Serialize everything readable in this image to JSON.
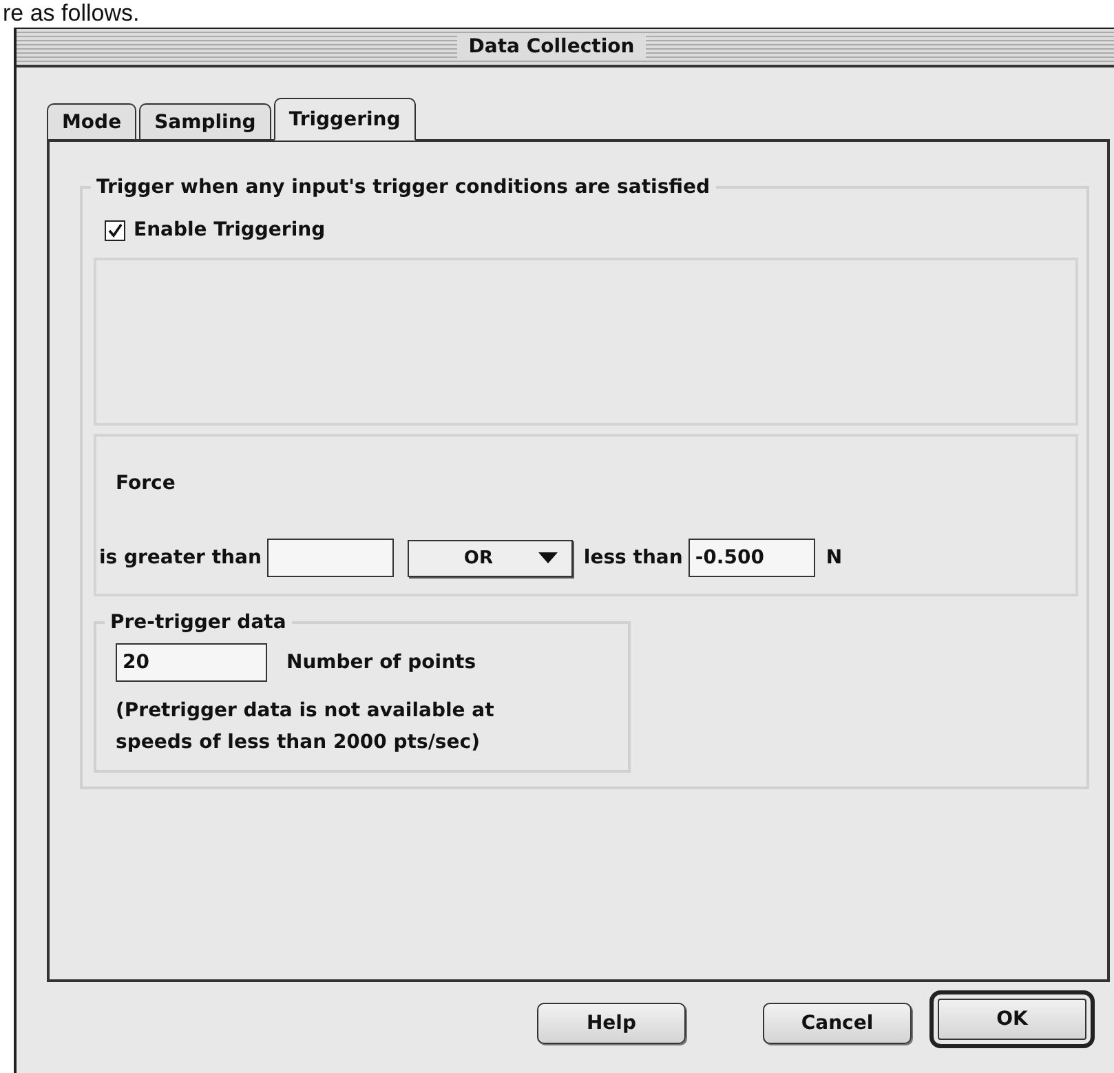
{
  "document_text": "re as follows.",
  "window": {
    "title": "Data Collection"
  },
  "tabs": [
    {
      "label": "Mode",
      "selected": false
    },
    {
      "label": "Sampling",
      "selected": false
    },
    {
      "label": "Triggering",
      "selected": true
    }
  ],
  "trigger_group": {
    "title": "Trigger when any input's trigger conditions are satisfied",
    "enable": {
      "label": "Enable Triggering",
      "checked": true
    },
    "condition": {
      "sensor": "Force",
      "greater_label": "is greater than",
      "operator": "OR",
      "less_label": "less than",
      "less_value": "-0.500",
      "unit": "N"
    },
    "pretrigger": {
      "title": "Pre-trigger data",
      "points": "20",
      "points_label": "Number of points",
      "note_lines": [
        "(Pretrigger data is not available at",
        "speeds of less than 2000 pts/sec)"
      ]
    }
  },
  "buttons": [
    {
      "label": "Help",
      "default": false
    },
    {
      "label": "Cancel",
      "default": false
    },
    {
      "label": "OK",
      "default": true
    }
  ]
}
